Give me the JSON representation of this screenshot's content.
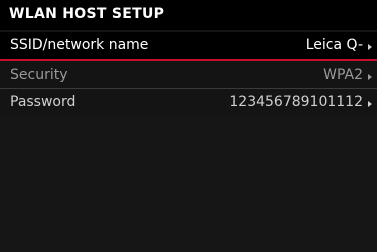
{
  "header": {
    "title": "WLAN HOST SETUP"
  },
  "menu": {
    "items": [
      {
        "label": "SSID/network name",
        "value": "Leica Q-"
      },
      {
        "label": "Security",
        "value": "WPA2"
      },
      {
        "label": "Password",
        "value": "123456789101112"
      }
    ]
  },
  "colors": {
    "accent": "#c8102e",
    "background": "#141414",
    "text": "#ffffff",
    "dim_text": "#9a9a9a"
  }
}
